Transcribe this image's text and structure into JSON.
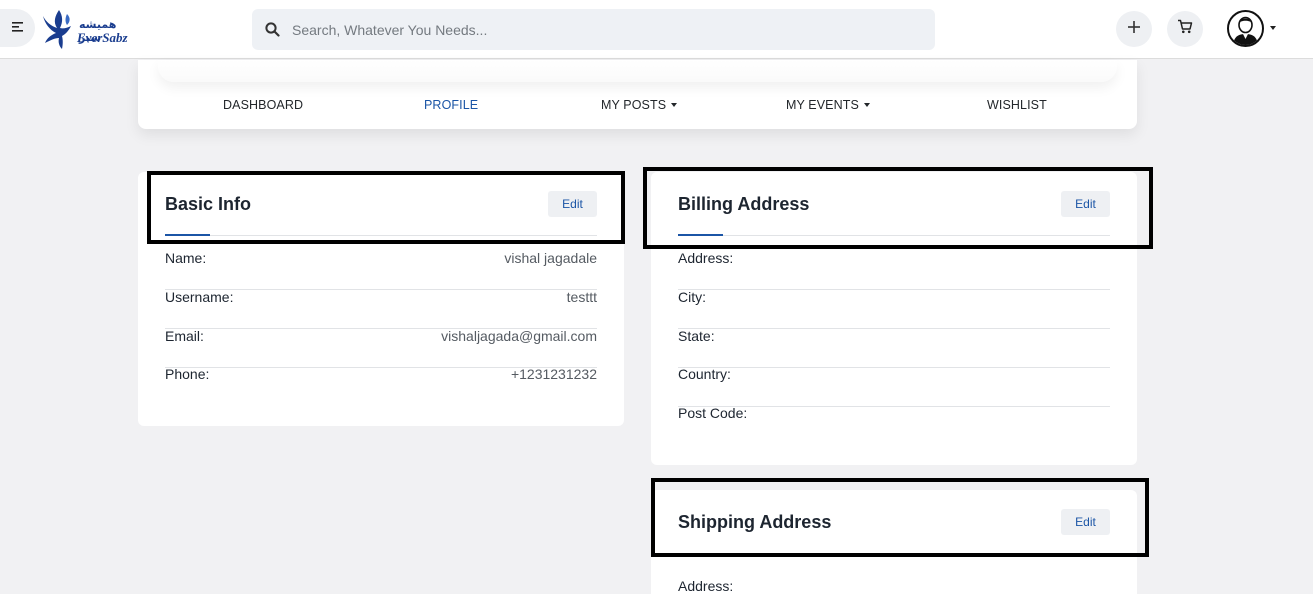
{
  "header": {
    "brand_farsi": "همیشه سبز",
    "brand_english": "EverSabz",
    "search_placeholder": "Search, Whatever You Needs...",
    "icons": [
      "menu-icon",
      "search-icon",
      "plus-icon",
      "cart-icon",
      "user-avatar-icon"
    ]
  },
  "nav": {
    "items": [
      {
        "label": "DASHBOARD",
        "dropdown": false,
        "active": false
      },
      {
        "label": "PROFILE",
        "dropdown": false,
        "active": true
      },
      {
        "label": "MY POSTS",
        "dropdown": true,
        "active": false
      },
      {
        "label": "MY EVENTS",
        "dropdown": true,
        "active": false
      },
      {
        "label": "WISHLIST",
        "dropdown": false,
        "active": false
      }
    ]
  },
  "basic_info": {
    "title": "Basic Info",
    "edit_label": "Edit",
    "rows": [
      {
        "label": "Name:",
        "value": "vishal jagadale"
      },
      {
        "label": "Username:",
        "value": "testtt"
      },
      {
        "label": "Email:",
        "value": "vishaljagada@gmail.com"
      },
      {
        "label": "Phone:",
        "value": "+1231231232"
      }
    ]
  },
  "billing": {
    "title": "Billing Address",
    "edit_label": "Edit",
    "rows": [
      {
        "label": "Address:",
        "value": ""
      },
      {
        "label": "City:",
        "value": ""
      },
      {
        "label": "State:",
        "value": ""
      },
      {
        "label": "Country:",
        "value": ""
      },
      {
        "label": "Post Code:",
        "value": ""
      }
    ]
  },
  "shipping": {
    "title": "Shipping Address",
    "edit_label": "Edit",
    "rows": [
      {
        "label": "Address:",
        "value": ""
      }
    ]
  },
  "colors": {
    "accent": "#1b55a6",
    "background": "#f1f1f3",
    "highlight_border": "#000000"
  }
}
